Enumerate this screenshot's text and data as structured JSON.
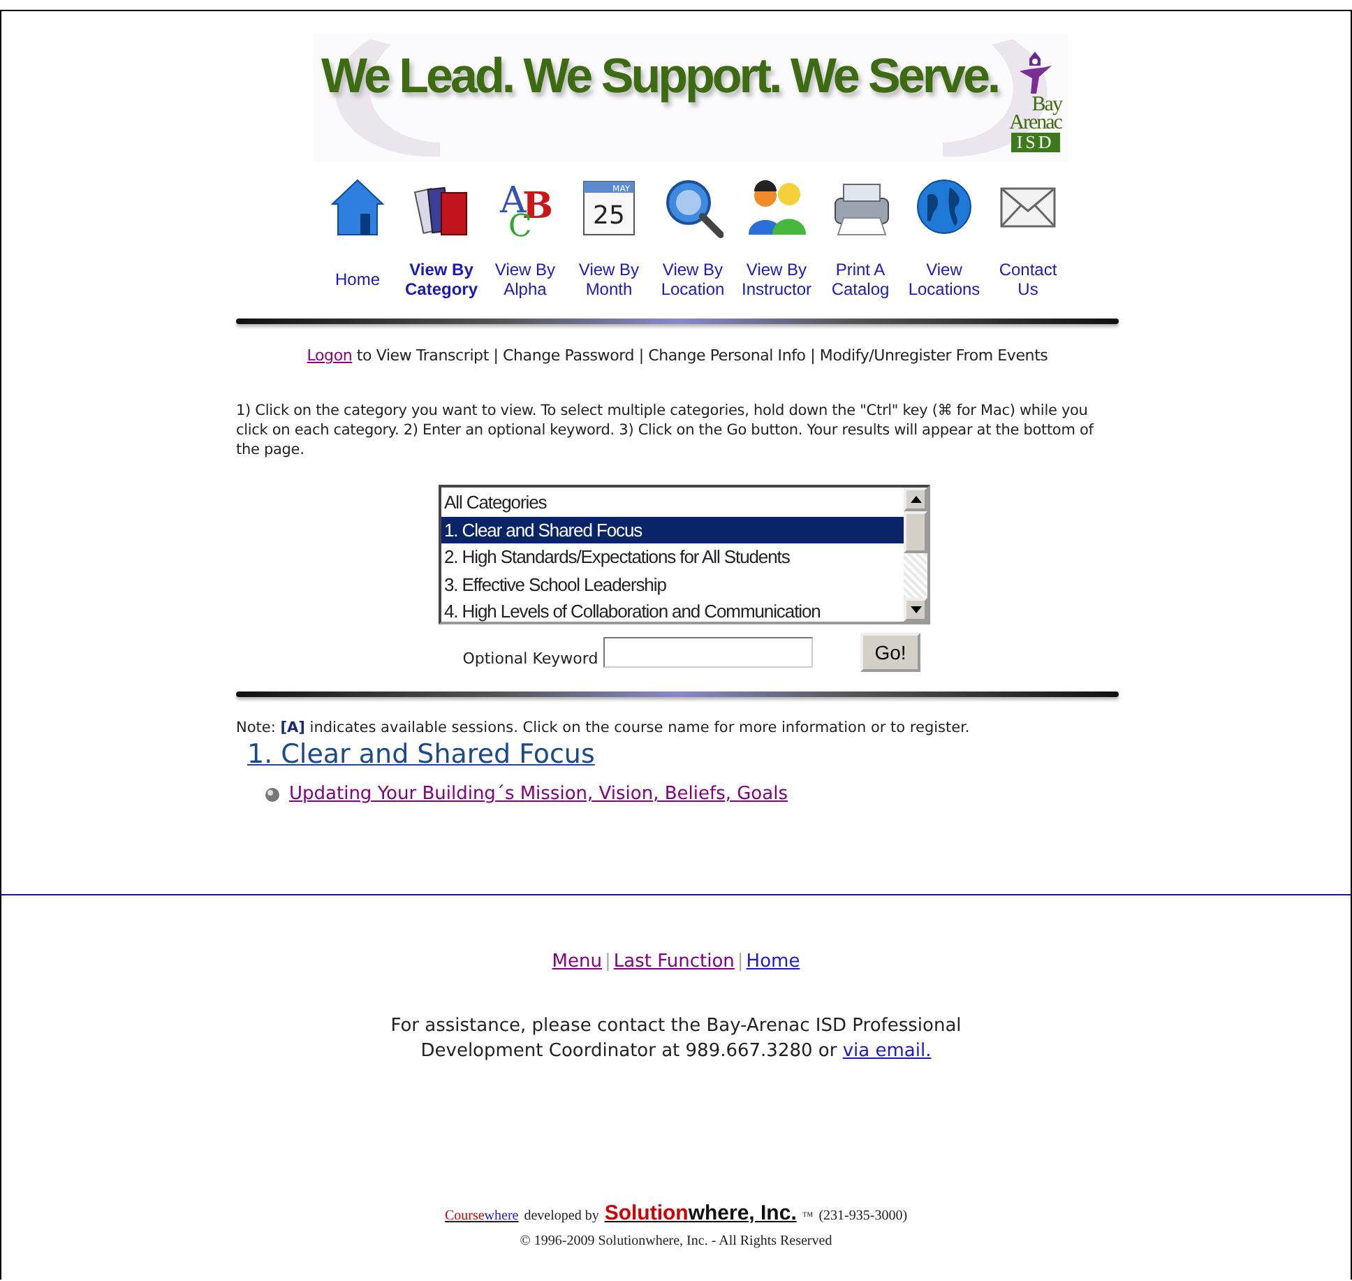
{
  "banner": {
    "slogan": "We Lead. We Support. We Serve.",
    "logo_lines": [
      "Bay",
      "Arenac"
    ],
    "logo_badge": "ISD"
  },
  "nav": [
    {
      "label": "Home",
      "kind": "home",
      "selected": false
    },
    {
      "label": "View By Category",
      "kind": "books",
      "selected": true
    },
    {
      "label": "View By Alpha",
      "kind": "abc",
      "selected": false,
      "icon_text": [
        "A",
        "B",
        "C"
      ]
    },
    {
      "label": "View By Month",
      "kind": "calendar",
      "selected": false,
      "icon_text": [
        "MAY",
        "25"
      ]
    },
    {
      "label": "View By Location",
      "kind": "magnifier",
      "selected": false
    },
    {
      "label": "View By Instructor",
      "kind": "people",
      "selected": false
    },
    {
      "label": "Print A Catalog",
      "kind": "printer",
      "selected": false
    },
    {
      "label": "View Locations",
      "kind": "globe",
      "selected": false
    },
    {
      "label": "Contact Us",
      "kind": "envelope",
      "selected": false
    }
  ],
  "account_bar": {
    "link": {
      "text": "Logon",
      "visited": true
    },
    "text": "to View Transcript | Change Password | Change Personal Info | Modify/Unregister From Events"
  },
  "instructions": "1) Click on the category you want to view. To select multiple categories, hold down the \"Ctrl\" key (⌘ for Mac) while you click on each category. 2) Enter an optional keyword. 3) Click on the Go button. Your results will appear at the bottom of the page.",
  "category_list": [
    {
      "text": "All Categories",
      "selected": false
    },
    {
      "text": "1. Clear and Shared Focus",
      "selected": true
    },
    {
      "text": "2. High Standards/Expectations for All Students",
      "selected": false
    },
    {
      "text": "3. Effective School Leadership",
      "selected": false
    },
    {
      "text": "4. High Levels of Collaboration and Communication",
      "selected": false
    }
  ],
  "keyword": {
    "label": "Optional Keyword",
    "button": "Go!"
  },
  "note": "Note: **[A]** indicates available sessions. Click on the course name for more information or to register.",
  "results": [
    {
      "heading": "1. Clear and Shared Focus",
      "courses": [
        {
          "text": "Updating Your Building´s Mission, Vision, Beliefs, Goals",
          "visited": true
        }
      ]
    }
  ],
  "footer_links": [
    {
      "kind": "link",
      "text": "Menu",
      "visited": true
    },
    {
      "kind": "separator",
      "text": "|"
    },
    {
      "kind": "link",
      "text": "Last Function",
      "visited": true
    },
    {
      "kind": "separator",
      "text": "|"
    },
    {
      "kind": "link",
      "text": "Home",
      "visited": false
    }
  ],
  "assistance": {
    "text": "For assistance, please contact the Bay-Arenac ISD Professional Development Coordinator at 989.667.3280 or",
    "link": {
      "text": "via email.",
      "visited": false
    }
  },
  "credit": {
    "product_parts": [
      "Course",
      "where"
    ],
    "developed_by": "developed by",
    "company_parts": [
      "Solution",
      "where, Inc."
    ],
    "trademark": "™",
    "phone": "(231-935-3000)"
  },
  "copyright": "© 1996-2009 Solutionwhere, Inc. - All Rights Reserved"
}
